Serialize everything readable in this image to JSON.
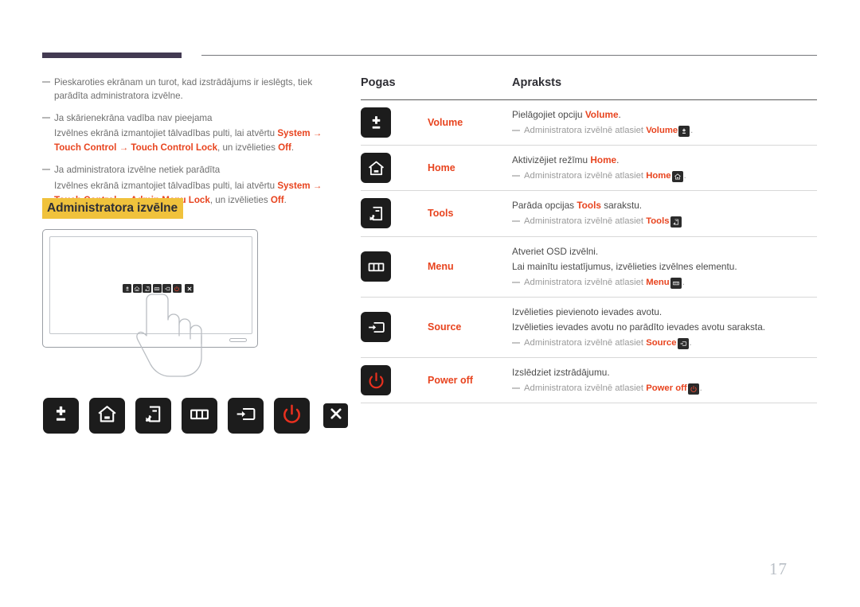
{
  "page": {
    "number": "17",
    "accent_orange": "#e8441f",
    "highlight_yellow": "#f0c23c",
    "rule_purple": "#433a52"
  },
  "notes": [
    {
      "head": "Pieskaroties ekrānam un turot, kad izstrādājums ir ieslēgts, tiek parādīta administratora izvēlne.",
      "sub_parts": []
    },
    {
      "head": "Ja skārienekrāna vadība nav pieejama",
      "sub_parts": [
        {
          "t": "Izvēlnes ekrānā izmantojiet tālvadības pulti, lai atvērtu ",
          "style": "plain"
        },
        {
          "t": "System",
          "style": "accent"
        },
        {
          "t": " → ",
          "style": "accent"
        },
        {
          "t": "Touch Control",
          "style": "accent"
        },
        {
          "t": " → ",
          "style": "accent"
        },
        {
          "t": "Touch Control Lock",
          "style": "accent"
        },
        {
          "t": ", un izvēlieties ",
          "style": "plain"
        },
        {
          "t": "Off",
          "style": "accent"
        },
        {
          "t": ".",
          "style": "plain"
        }
      ]
    },
    {
      "head": "Ja administratora izvēlne netiek parādīta",
      "sub_parts": [
        {
          "t": "Izvēlnes ekrānā izmantojiet tālvadības pulti, lai atvērtu ",
          "style": "plain"
        },
        {
          "t": "System",
          "style": "accent"
        },
        {
          "t": " → ",
          "style": "accent"
        },
        {
          "t": "Touch Control",
          "style": "accent"
        },
        {
          "t": " → ",
          "style": "accent"
        },
        {
          "t": "Admin Menu Lock",
          "style": "accent"
        },
        {
          "t": ", un izvēlieties ",
          "style": "plain"
        },
        {
          "t": "Off",
          "style": "accent"
        },
        {
          "t": ".",
          "style": "plain"
        }
      ]
    }
  ],
  "section_heading": "Administratora izvēlne",
  "illustration": {
    "name": "touchscreen-display-with-hand",
    "mini_keys": [
      "volume-icon",
      "home-icon",
      "tools-icon",
      "menu-icon",
      "source-icon",
      "power-icon",
      "close-icon"
    ]
  },
  "key_row": [
    {
      "icon": "volume-icon",
      "label": "Volume"
    },
    {
      "icon": "home-icon",
      "label": "Home"
    },
    {
      "icon": "tools-icon",
      "label": "Tools"
    },
    {
      "icon": "menu-icon",
      "label": "Menu"
    },
    {
      "icon": "source-icon",
      "label": "Source"
    },
    {
      "icon": "power-icon",
      "label": "Power off"
    },
    {
      "icon": "close-icon",
      "label": "Close"
    }
  ],
  "table": {
    "headers": {
      "buttons": "Pogas",
      "description": "Apraksts"
    },
    "rows": [
      {
        "icon": "volume-icon",
        "name": "Volume",
        "lines": [
          [
            {
              "t": "Pielāgojiet opciju ",
              "style": "plain"
            },
            {
              "t": "Volume",
              "style": "accent"
            },
            {
              "t": ".",
              "style": "plain"
            }
          ]
        ],
        "subnote": [
          {
            "t": "Administratora izvēlnē atlasiet ",
            "style": "plain"
          },
          {
            "t": "Volume",
            "style": "accent"
          },
          {
            "t": "ICON:volume-icon",
            "style": "badge"
          },
          {
            "t": ".",
            "style": "plain"
          }
        ]
      },
      {
        "icon": "home-icon",
        "name": "Home",
        "lines": [
          [
            {
              "t": "Aktivizējiet režīmu ",
              "style": "plain"
            },
            {
              "t": "Home",
              "style": "accent"
            },
            {
              "t": ".",
              "style": "plain"
            }
          ]
        ],
        "subnote": [
          {
            "t": "Administratora izvēlnē atlasiet ",
            "style": "plain"
          },
          {
            "t": "Home",
            "style": "accent"
          },
          {
            "t": "ICON:home-icon",
            "style": "badge"
          },
          {
            "t": ".",
            "style": "plain"
          }
        ]
      },
      {
        "icon": "tools-icon",
        "name": "Tools",
        "lines": [
          [
            {
              "t": "Parāda opcijas ",
              "style": "plain"
            },
            {
              "t": "Tools",
              "style": "accent"
            },
            {
              "t": " sarakstu.",
              "style": "plain"
            }
          ]
        ],
        "subnote": [
          {
            "t": "Administratora izvēlnē atlasiet ",
            "style": "plain"
          },
          {
            "t": "Tools",
            "style": "accent"
          },
          {
            "t": "ICON:tools-icon",
            "style": "badge"
          },
          {
            "t": "",
            "style": "plain"
          }
        ]
      },
      {
        "icon": "menu-icon",
        "name": "Menu",
        "lines": [
          [
            {
              "t": "Atveriet OSD izvēlni.",
              "style": "plain"
            }
          ],
          [
            {
              "t": "Lai mainītu iestatījumus, izvēlieties izvēlnes elementu.",
              "style": "plain"
            }
          ]
        ],
        "subnote": [
          {
            "t": "Administratora izvēlnē atlasiet ",
            "style": "plain"
          },
          {
            "t": "Menu",
            "style": "accent"
          },
          {
            "t": "ICON:menu-icon",
            "style": "badge"
          },
          {
            "t": ".",
            "style": "plain"
          }
        ]
      },
      {
        "icon": "source-icon",
        "name": "Source",
        "lines": [
          [
            {
              "t": "Izvēlieties pievienoto ievades avotu.",
              "style": "plain"
            }
          ],
          [
            {
              "t": "Izvēlieties ievades avotu no parādīto ievades avotu saraksta.",
              "style": "plain"
            }
          ]
        ],
        "subnote": [
          {
            "t": "Administratora izvēlnē atlasiet ",
            "style": "plain"
          },
          {
            "t": "Source",
            "style": "accent"
          },
          {
            "t": "ICON:source-icon",
            "style": "badge"
          },
          {
            "t": ".",
            "style": "plain"
          }
        ]
      },
      {
        "icon": "power-icon",
        "name": "Power off",
        "lines": [
          [
            {
              "t": "Izslēdziet izstrādājumu.",
              "style": "plain"
            }
          ]
        ],
        "subnote": [
          {
            "t": "Administratora izvēlnē atlasiet ",
            "style": "plain"
          },
          {
            "t": "Power off",
            "style": "accent"
          },
          {
            "t": "ICON:power-icon",
            "style": "badge"
          },
          {
            "t": ".",
            "style": "plain"
          }
        ]
      }
    ]
  }
}
